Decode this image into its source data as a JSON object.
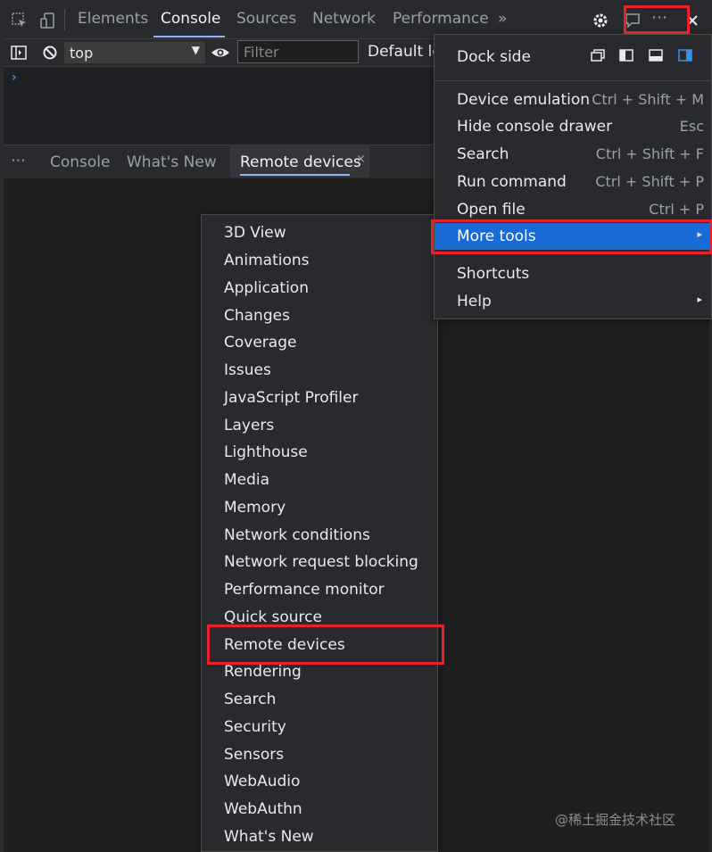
{
  "devtools": {
    "tabs": [
      "Elements",
      "Console",
      "Sources",
      "Network",
      "Performance"
    ],
    "active_tab": "Console",
    "more_tabs_glyph": "»"
  },
  "toolbar": {
    "context": "top",
    "filter_placeholder": "Filter",
    "levels_label": "Default le"
  },
  "console": {
    "prompt": "›"
  },
  "drawer": {
    "menu_glyph": "⋯",
    "tabs": [
      "Console",
      "What's New",
      "Remote devices"
    ],
    "active_tab": "Remote devices",
    "close_glyph": "×"
  },
  "main_menu": {
    "dock_side_label": "Dock side",
    "items": [
      {
        "label": "Device emulation",
        "shortcut": "Ctrl + Shift + M"
      },
      {
        "label": "Hide console drawer",
        "shortcut": "Esc"
      },
      {
        "label": "Search",
        "shortcut": "Ctrl + Shift + F"
      },
      {
        "label": "Run command",
        "shortcut": "Ctrl + Shift + P"
      },
      {
        "label": "Open file",
        "shortcut": "Ctrl + P"
      },
      {
        "label": "More tools",
        "shortcut": ""
      },
      {
        "label": "Shortcuts",
        "shortcut": ""
      },
      {
        "label": "Help",
        "shortcut": ""
      }
    ],
    "highlighted": "More tools",
    "submenu_arrow": "▸"
  },
  "more_tools_menu": {
    "items": [
      "3D View",
      "Animations",
      "Application",
      "Changes",
      "Coverage",
      "Issues",
      "JavaScript Profiler",
      "Layers",
      "Lighthouse",
      "Media",
      "Memory",
      "Network conditions",
      "Network request blocking",
      "Performance monitor",
      "Quick source",
      "Remote devices",
      "Rendering",
      "Search",
      "Security",
      "Sensors",
      "WebAudio",
      "WebAuthn",
      "What's New"
    ]
  },
  "watermark": "@稀土掘金技术社区",
  "colors": {
    "accent_blue": "#1a6ad6",
    "tab_underline": "#8ab4f8",
    "annotation_red": "#e8212a",
    "background": "#1f1f1f",
    "panel": "#292a2d"
  },
  "icons": {
    "inspect": "inspect-element-icon",
    "device": "device-toggle-icon",
    "settings": "gear-icon",
    "feedback": "feedback-icon",
    "more": "more-vert-icon",
    "close": "close-icon",
    "sidebar": "sidebar-toggle-icon",
    "clear": "clear-console-icon",
    "eye": "live-expression-eye-icon"
  }
}
